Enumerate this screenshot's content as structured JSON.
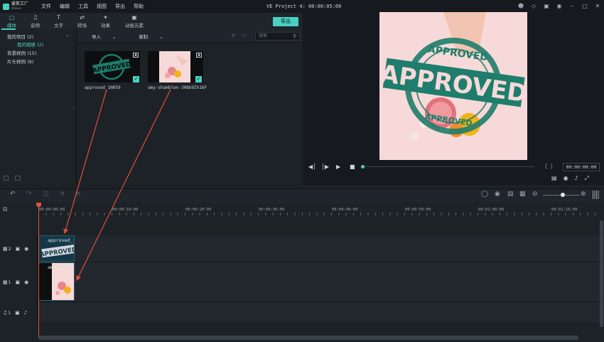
{
  "app": {
    "logo_line1": "爱剪工厂",
    "logo_line2": "Wwww",
    "window_title": "VE Project 4: 00:00:05:00",
    "menus": [
      "文件",
      "编辑",
      "工具",
      "视图",
      "导出",
      "帮助"
    ]
  },
  "tabs": [
    {
      "label": "媒体",
      "icon": "folder-icon"
    },
    {
      "label": "音频",
      "icon": "music-icon"
    },
    {
      "label": "文字",
      "icon": "text-icon"
    },
    {
      "label": "转场",
      "icon": "transition-icon"
    },
    {
      "label": "效果",
      "icon": "effects-icon"
    },
    {
      "label": "动画元素",
      "icon": "image-icon"
    }
  ],
  "export_label": "导出",
  "tree": {
    "my_projects": "我的项目 (2)",
    "my_media": "我的相册 (2)",
    "bg_samples": "背景样例 (15)",
    "title_samples": "片头样例 (9)"
  },
  "media_toolbar": {
    "import_label": "导入",
    "record_label": "录制",
    "search_placeholder": "搜索"
  },
  "media": [
    {
      "label": "approved_1N059"
    },
    {
      "label": "amy-shamblen-308b9Ih16F"
    }
  ],
  "stamp_text": "APPROVED",
  "preview": {
    "timecode": "00:00:00:00",
    "brackets": "{ }"
  },
  "ruler": [
    "00:00:00:00",
    "00:00:10:00",
    "00:00:20:00",
    "00:00:30:00",
    "00:00:40:00",
    "00:00:50:00",
    "00:01:00:00",
    "00:01:10:00"
  ],
  "tracks": [
    {
      "num": "2",
      "clip_label": "approved_"
    },
    {
      "num": "1",
      "clip_label": "amy-shamb"
    },
    {
      "num": "1"
    }
  ],
  "colors": {
    "accent": "#49d0c2",
    "arrow": "#e0503c",
    "stamp": "#1e7d6c",
    "pink": "#f6d9d8"
  }
}
